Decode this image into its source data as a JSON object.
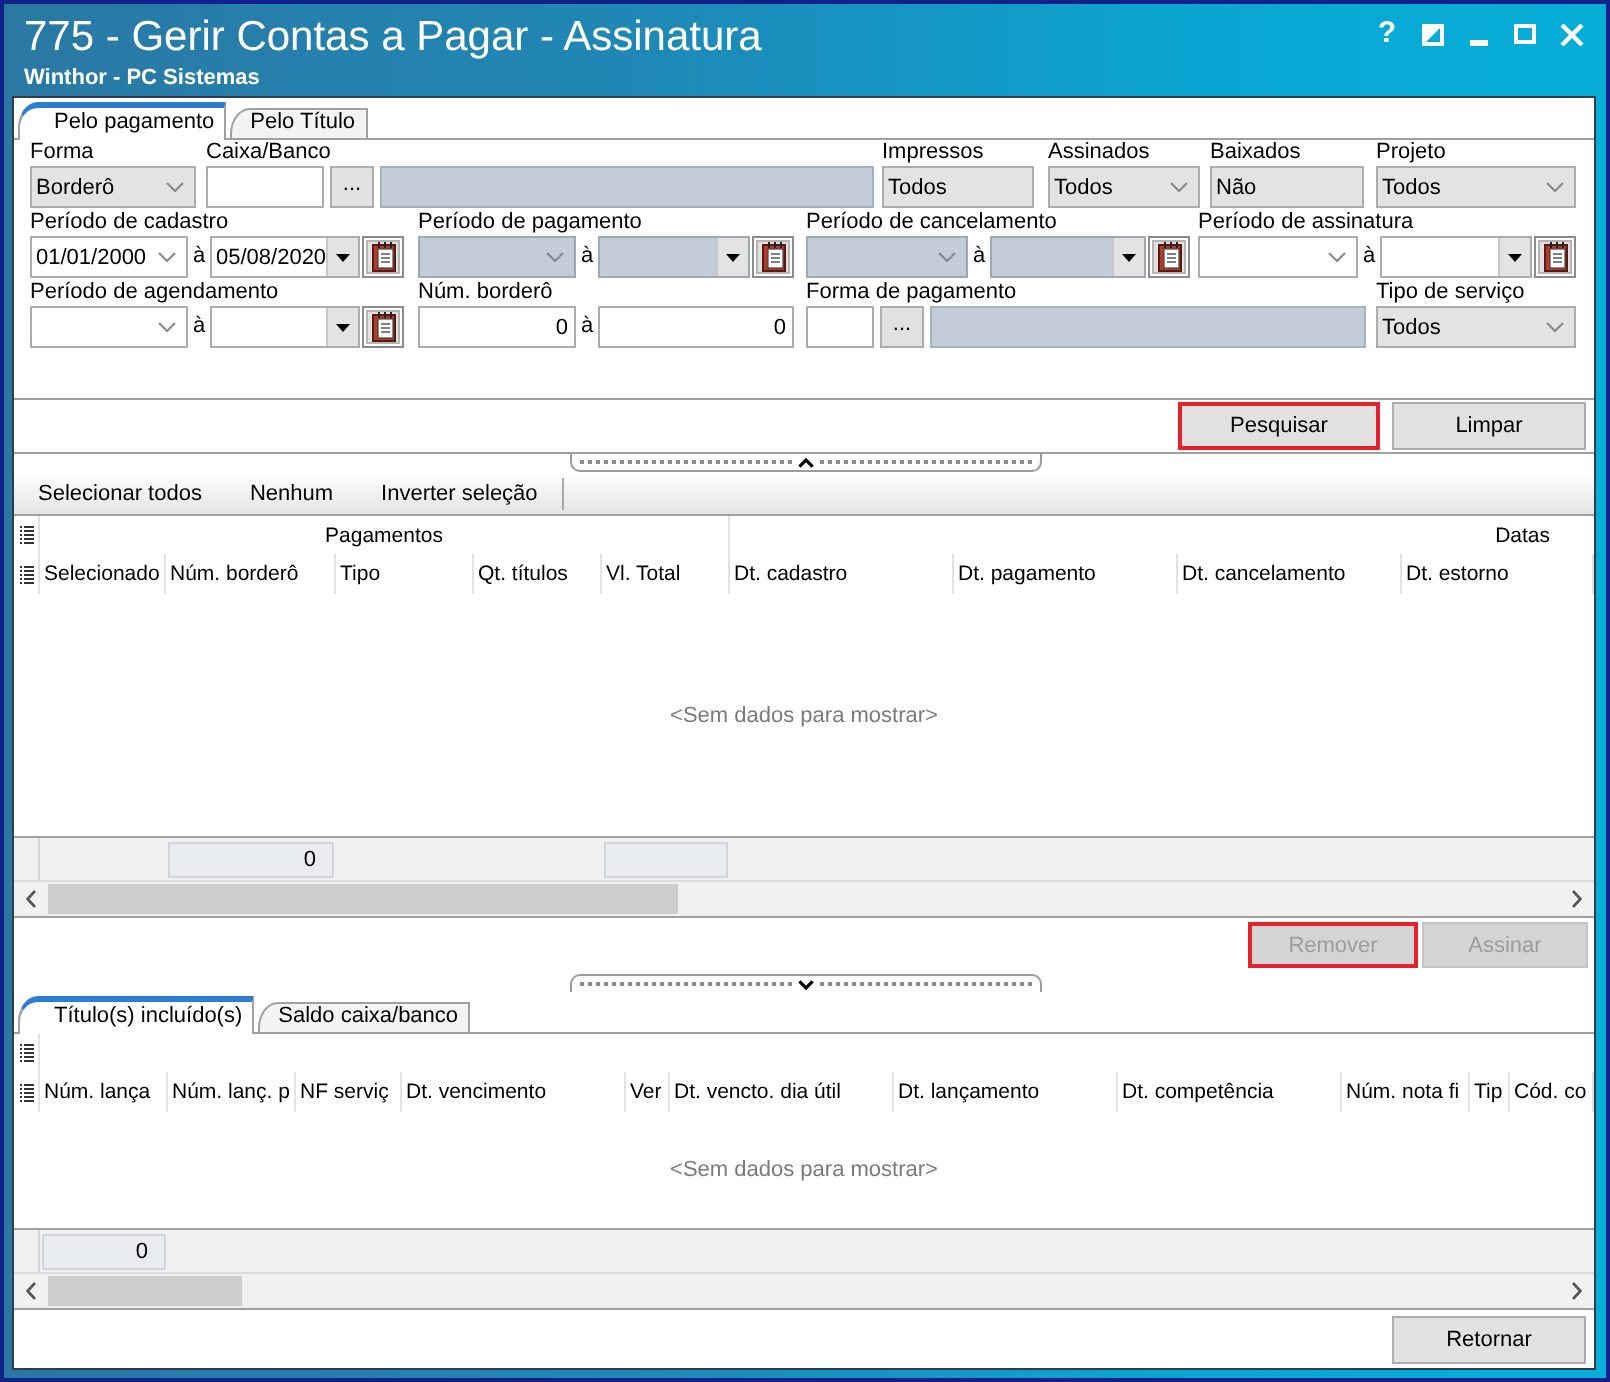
{
  "window": {
    "title": "775 - Gerir Contas a Pagar - Assinatura",
    "subtitle": "Winthor - PC Sistemas",
    "help": "?"
  },
  "filter_tabs": [
    {
      "label": "Pelo pagamento",
      "selected": true
    },
    {
      "label": "Pelo Título",
      "selected": false
    }
  ],
  "filters": {
    "rows": [
      {
        "fields": [
          {
            "kind": "combo",
            "label": "Forma",
            "value": "Borderô"
          },
          {
            "kind": "lookup",
            "label": "Caixa/Banco",
            "browse": "..."
          },
          {
            "kind": "readonly",
            "label": "Impressos",
            "value": "Todos"
          },
          {
            "kind": "combo",
            "label": "Assinados",
            "value": "Todos"
          },
          {
            "kind": "readonly",
            "label": "Baixados",
            "value": "Não"
          },
          {
            "kind": "combo",
            "label": "Projeto",
            "value": "Todos"
          }
        ]
      },
      {
        "fields": [
          {
            "kind": "date_range",
            "label": "Período de cadastro",
            "from": {
              "value": "01/01/2000",
              "disabled": false
            },
            "separator": "à",
            "to": {
              "value": "05/08/2020",
              "disabled": false
            }
          },
          {
            "kind": "date_range",
            "label": "Período de pagamento",
            "from": {
              "disabled": true
            },
            "separator": "à",
            "to": {
              "disabled": true
            }
          },
          {
            "kind": "date_range",
            "label": "Período de cancelamento",
            "from": {
              "disabled": true
            },
            "separator": "à",
            "to": {
              "disabled": true
            }
          },
          {
            "kind": "date_range",
            "label": "Período de assinatura",
            "from": {
              "disabled": false
            },
            "separator": "à",
            "to": {
              "disabled": false
            }
          }
        ]
      },
      {
        "fields": [
          {
            "kind": "date_range",
            "label": "Período de agendamento",
            "from": {
              "disabled": false
            },
            "separator": "à",
            "to": {
              "disabled": false
            }
          },
          {
            "kind": "number_range",
            "label": "Núm. borderô",
            "from": "0",
            "separator": "à",
            "to": "0"
          },
          {
            "kind": "lookup",
            "label": "Forma de pagamento",
            "browse": "..."
          },
          {
            "kind": "combo",
            "label": "Tipo de serviço",
            "value": "Todos"
          }
        ]
      }
    ]
  },
  "search_buttons": [
    {
      "label": "Pesquisar",
      "disabled": false,
      "highlighted": true
    },
    {
      "label": "Limpar",
      "disabled": false,
      "highlighted": false
    }
  ],
  "selection_toolbar": [
    "Selecionar todos",
    "Nenhum",
    "Inverter seleção"
  ],
  "payments_grid": {
    "bands": [
      {
        "label": "Pagamentos",
        "columns": [
          {
            "label": "Selecionado"
          },
          {
            "label": "Núm. borderô",
            "summary": "0"
          },
          {
            "label": "Tipo"
          },
          {
            "label": "Qt. títulos"
          },
          {
            "label": "Vl. Total",
            "summary_box": true
          }
        ]
      },
      {
        "label": "Datas",
        "columns": [
          {
            "label": "Dt. cadastro"
          },
          {
            "label": "Dt. pagamento"
          },
          {
            "label": "Dt. cancelamento"
          },
          {
            "label": "Dt. estorno"
          }
        ]
      }
    ],
    "empty_text": "<Sem dados para mostrar>"
  },
  "sign_buttons": [
    {
      "label": "Remover",
      "disabled": true,
      "highlighted": true
    },
    {
      "label": "Assinar",
      "disabled": true,
      "highlighted": false
    }
  ],
  "detail_tabs": [
    {
      "label": "Título(s) incluído(s)",
      "selected": true
    },
    {
      "label": "Saldo caixa/banco",
      "selected": false
    }
  ],
  "titles_grid": {
    "columns": [
      {
        "label": "Núm. lança",
        "summary": "0"
      },
      {
        "label": "Núm. lanç. p"
      },
      {
        "label": "NF serviç"
      },
      {
        "label": "Dt. vencimento"
      },
      {
        "label": "Ver"
      },
      {
        "label": "Dt. vencto. dia útil"
      },
      {
        "label": "Dt. lançamento"
      },
      {
        "label": "Dt. competência"
      },
      {
        "label": "Núm. nota fi"
      },
      {
        "label": "Tip"
      },
      {
        "label": "Cód. co"
      }
    ],
    "empty_text": "<Sem dados para mostrar>"
  },
  "footer_buttons": [
    {
      "label": "Retornar",
      "disabled": false,
      "highlighted": false
    }
  ]
}
